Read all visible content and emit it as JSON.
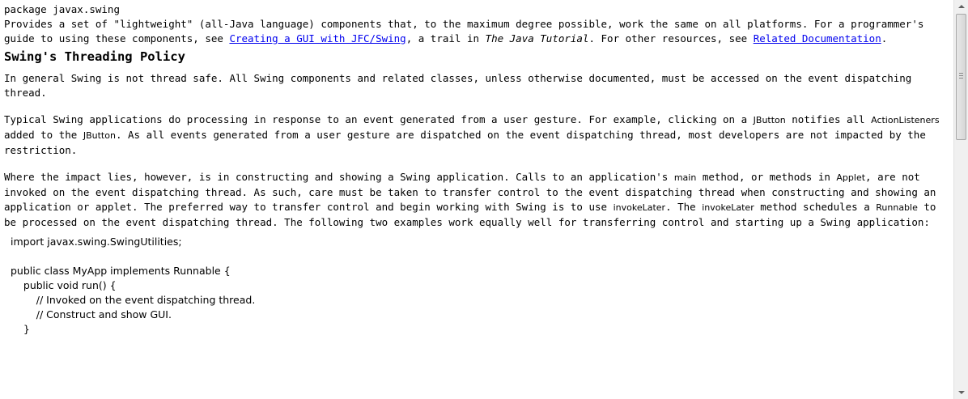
{
  "package_line": "package javax.swing",
  "intro": {
    "text_before_link1": "Provides a set of \"lightweight\" (all-Java language) components that, to the maximum degree possible, work the same on all platforms. For a programmer's guide to using these components, see ",
    "link1": "Creating a GUI with JFC/Swing",
    "text_after_link1": ", a trail in ",
    "italic_title": "The Java Tutorial",
    "text_before_link2": ". For other resources, see ",
    "link2": "Related Documentation",
    "text_end": "."
  },
  "heading": "Swing's Threading Policy",
  "para_general": "In general Swing is not thread safe. All Swing components and related classes, unless otherwise documented, must be accessed on the event dispatching thread.",
  "para_typical": {
    "t1": "Typical Swing applications do processing in response to an event generated from a user gesture. For example, clicking on a ",
    "c1": "JButton",
    "t2": " notifies all ",
    "c2": "ActionListeners",
    "t3": " added to the ",
    "c3": "JButton",
    "t4": ". As all events generated from a user gesture are dispatched on the event dispatching thread, most developers are not impacted by the restriction."
  },
  "para_impact": {
    "t1": "Where the impact lies, however, is in constructing and showing a Swing application. Calls to an application's ",
    "c1": "main",
    "t2": " method, or methods in ",
    "c2": "Applet",
    "t3": ", are not invoked on the event dispatching thread. As such, care must be taken to transfer control to the event dispatching thread when constructing and showing an application or applet. The preferred way to transfer control and begin working with Swing is to use ",
    "c3": "invokeLater",
    "t4": ". The ",
    "c4": "invokeLater",
    "t5": " method schedules a ",
    "c5": "Runnable",
    "t6": " to be processed on the event dispatching thread. The following two examples work equally well for transferring control and starting up a Swing application:"
  },
  "code_block": "import javax.swing.SwingUtilities;\n\npublic class MyApp implements Runnable {\n    public void run() {\n        // Invoked on the event dispatching thread.\n        // Construct and show GUI.\n    }"
}
